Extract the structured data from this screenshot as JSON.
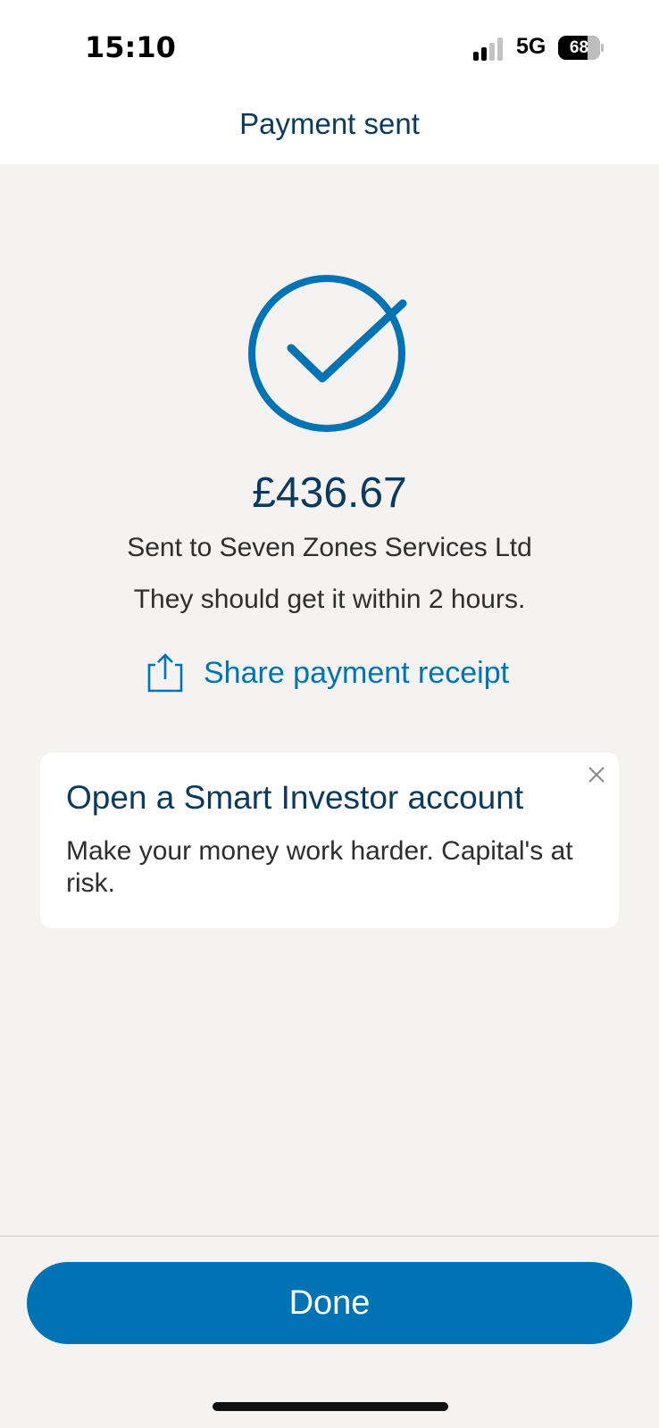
{
  "status_bar": {
    "time": "15:10",
    "network": "5G",
    "battery_level": "68",
    "battery_fraction": 0.68,
    "signal_bars_active": 2,
    "signal_bars_total": 4
  },
  "header": {
    "title": "Payment sent"
  },
  "confirmation": {
    "icon": "check-circle-icon",
    "amount": "£436.67",
    "recipient_text": "Sent to Seven Zones Services Ltd",
    "timing_text": "They should get it within 2 hours."
  },
  "share": {
    "icon": "share-icon",
    "label": "Share payment receipt"
  },
  "promo": {
    "title": "Open a Smart Investor account",
    "text": "Make your money work harder. Capital's at risk.",
    "close_icon": "close-icon"
  },
  "footer": {
    "done_label": "Done"
  },
  "colors": {
    "brand_blue": "#0073b4",
    "heading_navy": "#0b3a5c",
    "background": "#f4f3f2"
  }
}
